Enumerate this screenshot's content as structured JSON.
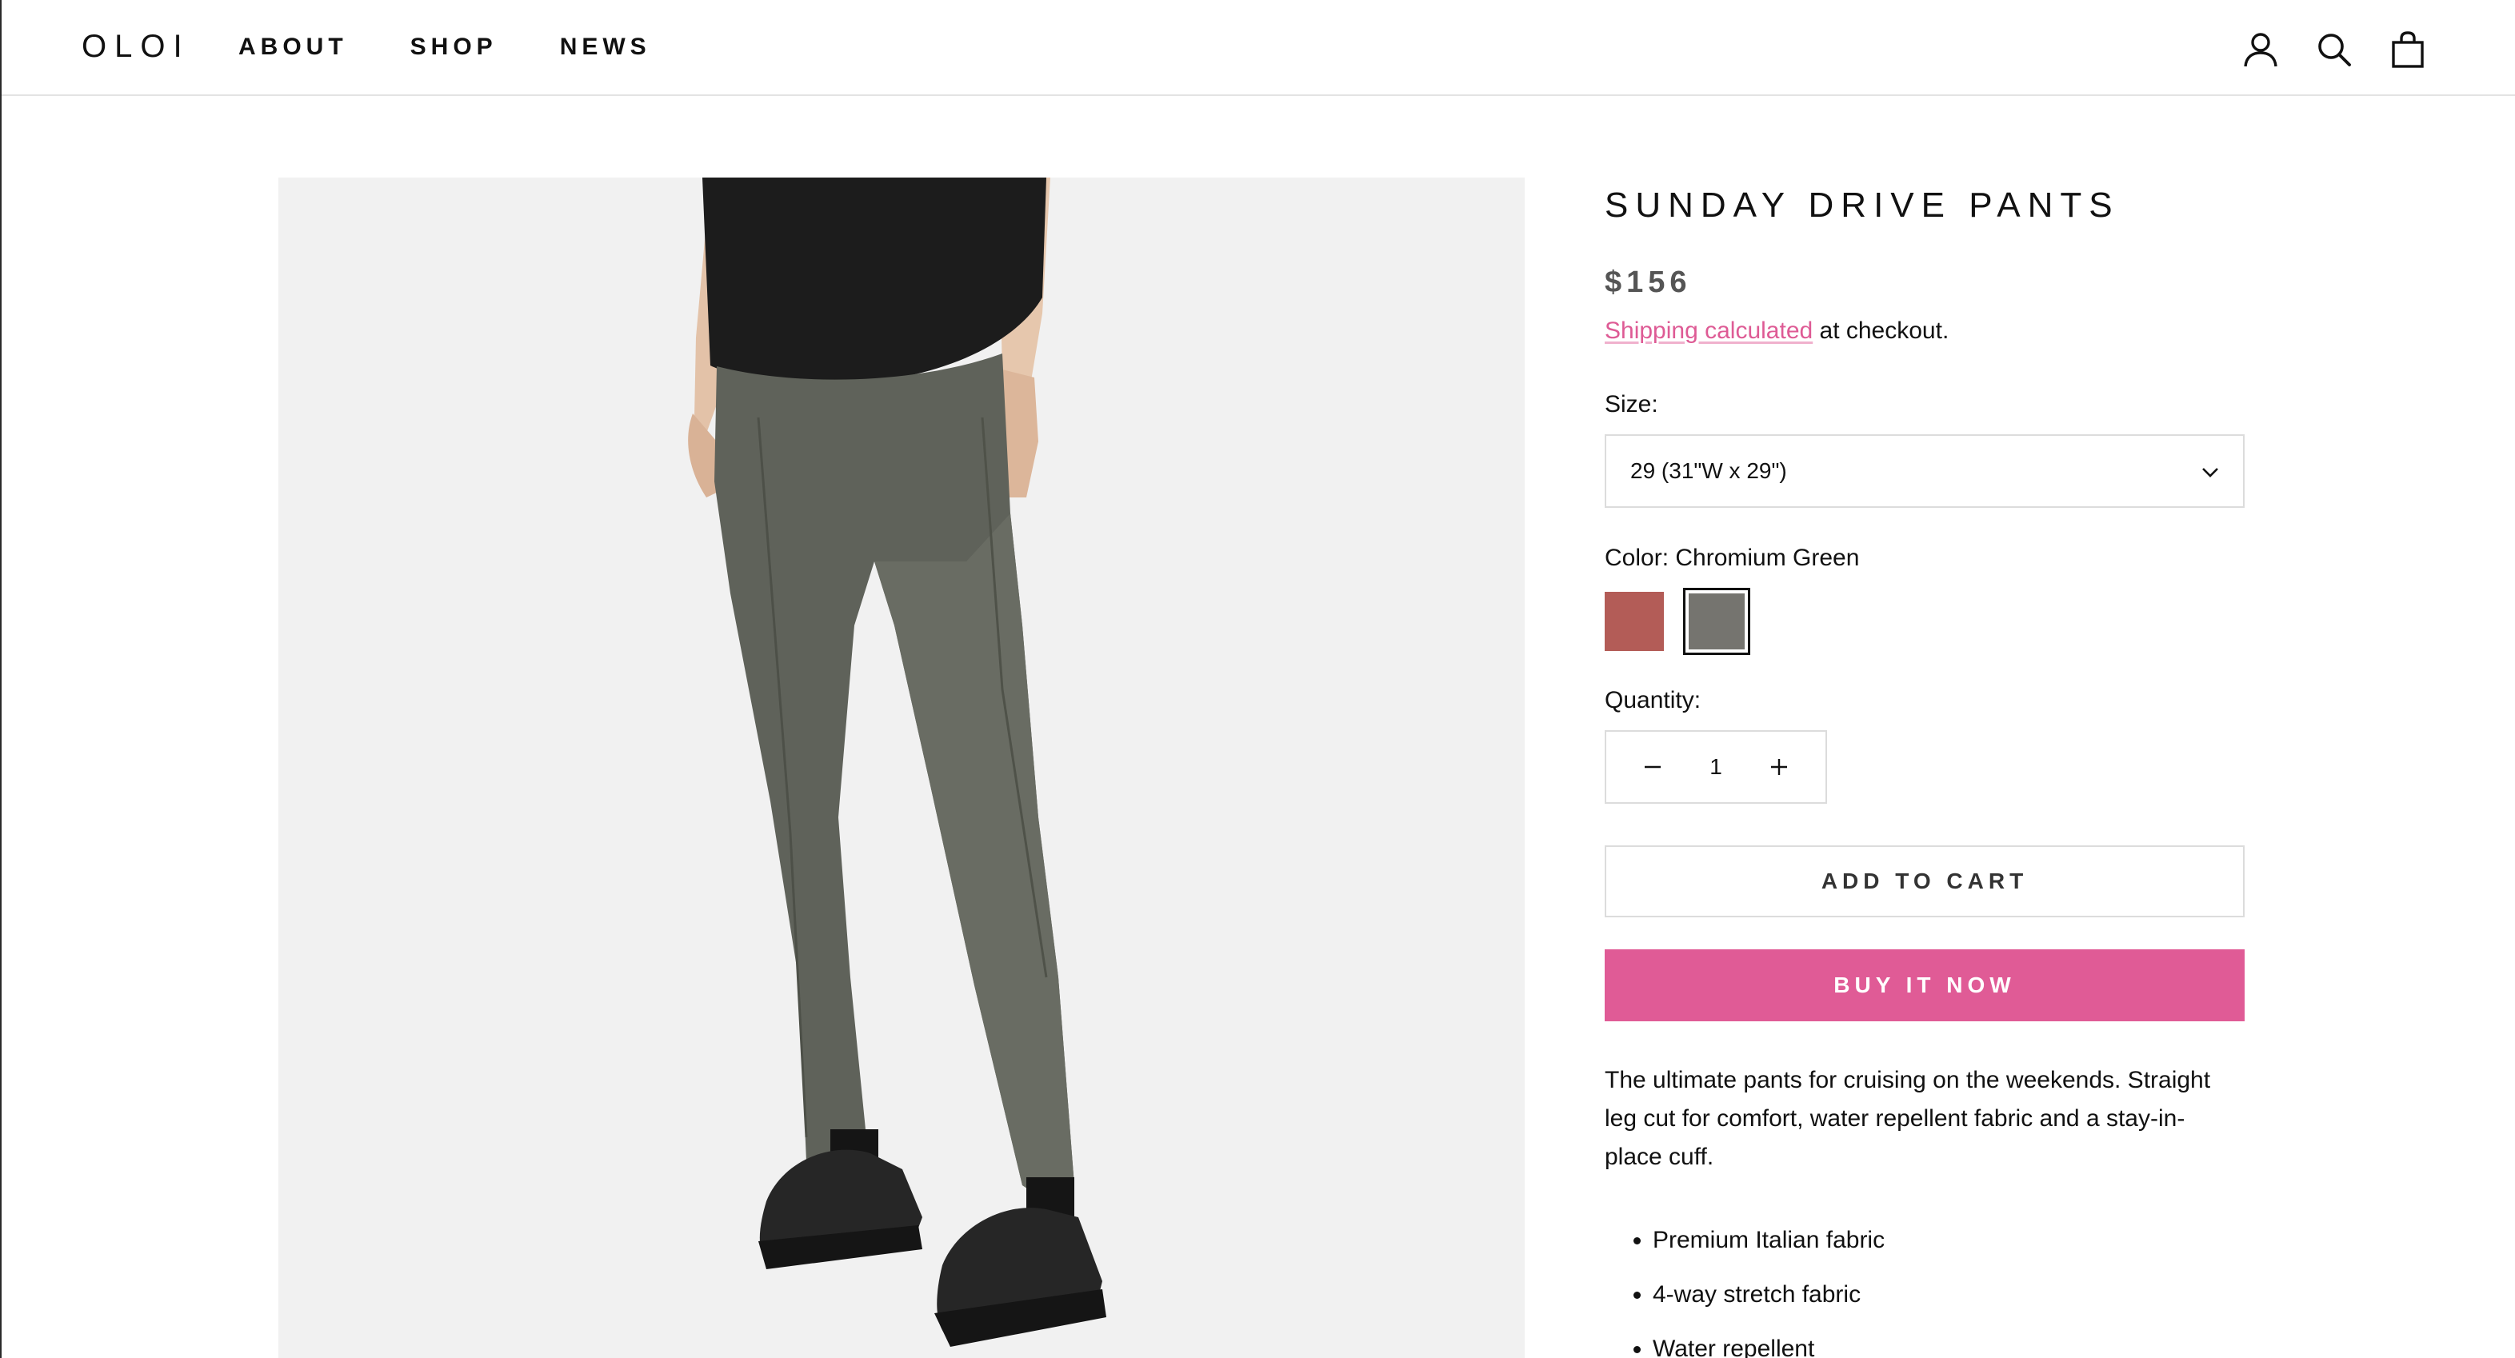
{
  "header": {
    "logo": "OLOI",
    "nav": [
      "ABOUT",
      "SHOP",
      "NEWS"
    ],
    "icons": [
      "account-icon",
      "search-icon",
      "cart-icon"
    ]
  },
  "product": {
    "title": "SUNDAY DRIVE PANTS",
    "price": "$156",
    "shipping_link": "Shipping calculated",
    "shipping_suffix": " at checkout.",
    "size_label": "Size:",
    "size_value": "29 (31\"W x 29\")",
    "color_label": "Color: Chromium Green",
    "swatches": [
      {
        "name": "rust",
        "color": "#b35c57",
        "selected": false
      },
      {
        "name": "chromium-green",
        "color": "#75746f",
        "selected": true
      }
    ],
    "quantity_label": "Quantity:",
    "quantity_value": "1",
    "add_to_cart": "ADD TO CART",
    "buy_now": "BUY IT NOW",
    "description": "The ultimate pants for cruising on the weekends. Straight leg cut for comfort, water repellent fabric and a stay-in-place cuff.",
    "features": [
      "Premium Italian fabric",
      "4-way stretch fabric",
      "Water repellent"
    ]
  },
  "colors": {
    "accent": "#e05b96",
    "link": "#de5b95",
    "image_bg": "#f1f1f1"
  }
}
